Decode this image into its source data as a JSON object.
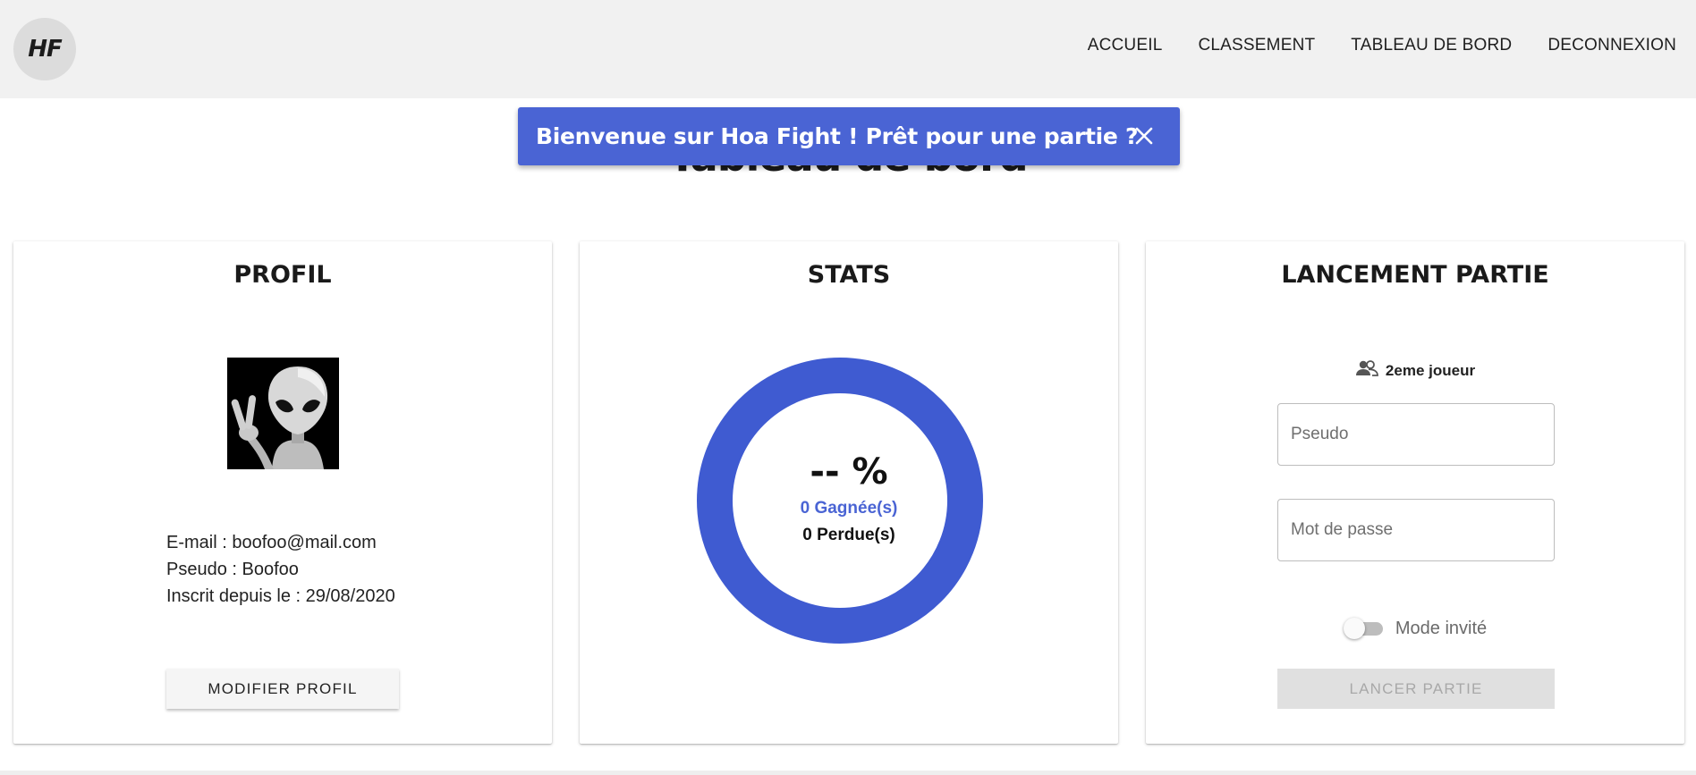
{
  "header": {
    "logo_text": "HF",
    "nav": [
      "ACCUEIL",
      "CLASSEMENT",
      "TABLEAU DE BORD",
      "DECONNEXION"
    ]
  },
  "page": {
    "title": "Tableau de bord"
  },
  "snackbar": {
    "message": "Bienvenue sur Hoa Fight ! Prêt pour une partie ?",
    "close_icon": "close-icon"
  },
  "profile": {
    "title": "PROFIL",
    "avatar_icon": "alien-icon",
    "email_line": "E-mail : boofoo@mail.com",
    "pseudo_line": "Pseudo : Boofoo",
    "since_line": "Inscrit depuis le : 29/08/2020",
    "button": "MODIFIER PROFIL"
  },
  "stats": {
    "title": "STATS",
    "percent": "-- %",
    "won": "0 Gagnée(s)",
    "lost": "0 Perdue(s)",
    "ring_color": "#3f5bd1"
  },
  "launch": {
    "title": "LANCEMENT PARTIE",
    "player2_icon": "people-icon",
    "player2_label": "2eme joueur",
    "pseudo_placeholder": "Pseudo",
    "password_placeholder": "Mot de passe",
    "guest_mode_label": "Mode invité",
    "guest_mode_on": false,
    "button": "LANCER PARTIE"
  },
  "colors": {
    "accent": "#4a64d4",
    "header_bg": "#f1f1f1"
  }
}
